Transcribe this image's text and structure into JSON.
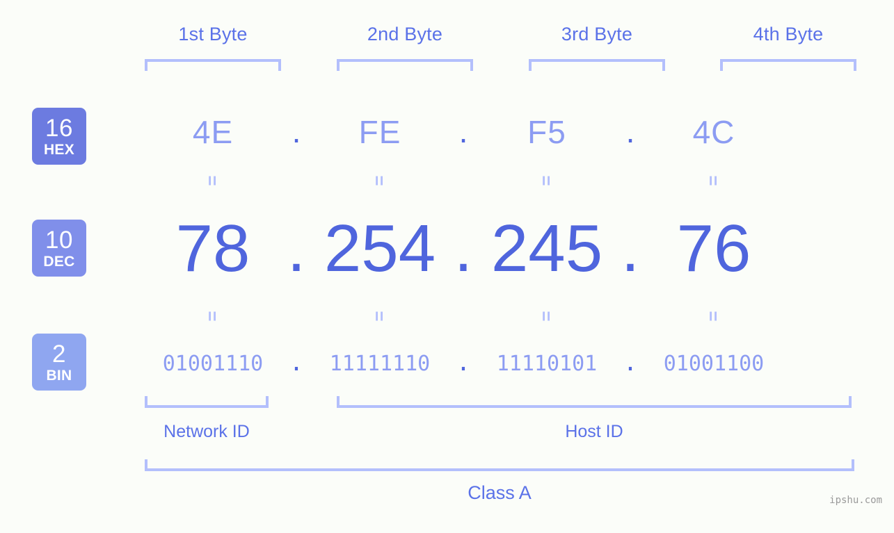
{
  "background_color": "#fbfdf9",
  "accent_colors": {
    "label_blue": "#5b72e8",
    "bracket_blue": "#b3bffc",
    "dec_blue": "#4f65dd",
    "light_blue": "#8c9cf2",
    "hex_badge": "#6c7be0",
    "dec_badge": "#808fea",
    "bin_badge": "#8fa6f0",
    "watermark_gray": "#9a9a9a"
  },
  "byte_headers": [
    {
      "label": "1st Byte"
    },
    {
      "label": "2nd Byte"
    },
    {
      "label": "3rd Byte"
    },
    {
      "label": "4th Byte"
    }
  ],
  "bases": [
    {
      "number": "16",
      "name": "HEX",
      "color": "#6c7be0"
    },
    {
      "number": "10",
      "name": "DEC",
      "color": "#808fea"
    },
    {
      "number": "2",
      "name": "BIN",
      "color": "#8fa6f0"
    }
  ],
  "separator": ".",
  "equals_mark": "=",
  "rows": {
    "hex": {
      "values": [
        "4E",
        "FE",
        "F5",
        "4C"
      ]
    },
    "dec": {
      "values": [
        "78",
        "254",
        "245",
        "76"
      ]
    },
    "bin": {
      "values": [
        "01001110",
        "11111110",
        "11110101",
        "01001100"
      ]
    }
  },
  "id_sections": [
    {
      "label": "Network ID"
    },
    {
      "label": "Host ID"
    }
  ],
  "class_label": "Class A",
  "watermark": "ipshu.com"
}
